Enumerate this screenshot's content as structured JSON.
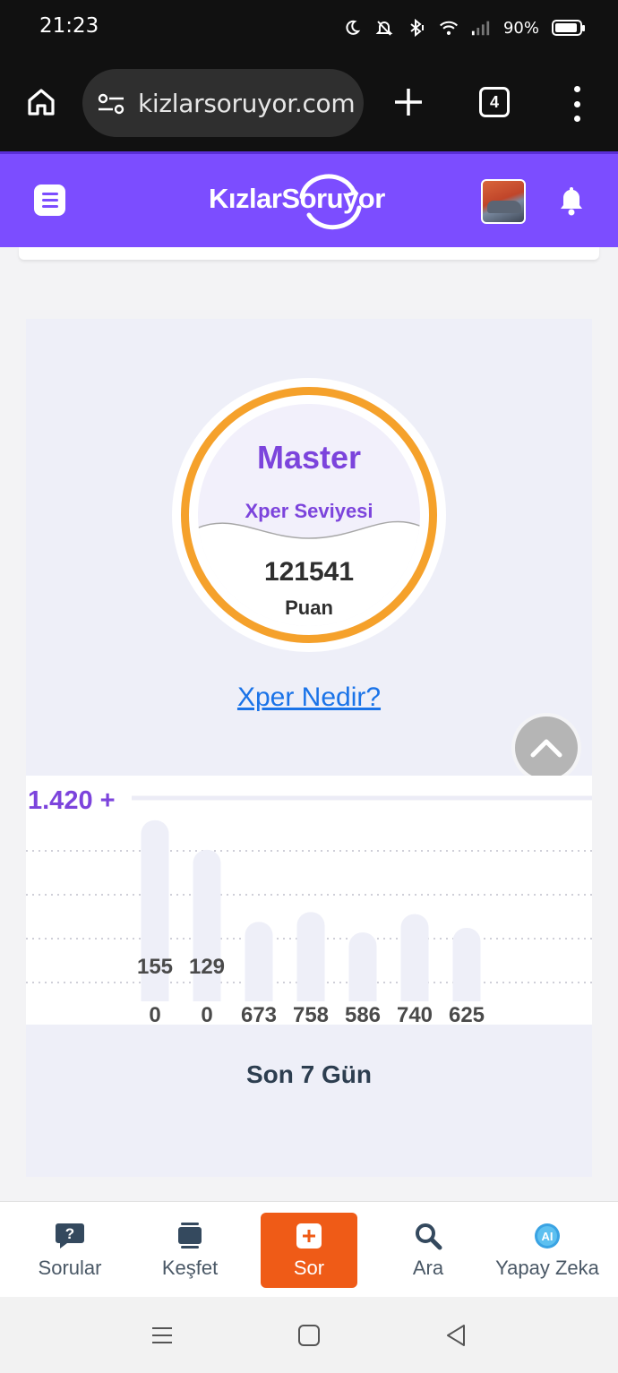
{
  "status_bar": {
    "time": "21:23",
    "battery": "90%"
  },
  "browser": {
    "url": "kizlarsoruyor.com",
    "tab_count": "4"
  },
  "site": {
    "logo": {
      "part1": "Kızlar",
      "part2": "Soruyor"
    }
  },
  "xper": {
    "level": "Master",
    "level_label": "Xper Seviyesi",
    "points": "121541",
    "points_label": "Puan",
    "link_text": "Xper Nedir?"
  },
  "chart_data": {
    "type": "bar",
    "max_label": "1.420 +",
    "categories": [
      "",
      "",
      "",
      "",
      "",
      "",
      ""
    ],
    "series": [
      {
        "values": [
          155,
          129,
          673,
          758,
          586,
          740,
          625
        ]
      },
      {
        "values": [
          0,
          0,
          673,
          758,
          586,
          740,
          625
        ]
      }
    ],
    "top_labels": [
      "155",
      "129",
      "",
      "",
      "",
      "",
      ""
    ],
    "bottom_labels": [
      "0",
      "0",
      "673",
      "758",
      "586",
      "740",
      "625"
    ],
    "bar_levels": [
      1380,
      1155,
      605,
      680,
      525,
      665,
      560
    ],
    "ylim": [
      0,
      1420
    ],
    "grid": true,
    "caption": "Son 7 Gün"
  },
  "bottom_nav": {
    "items": [
      {
        "label": "Sorular"
      },
      {
        "label": "Keşfet"
      },
      {
        "label": "Sor"
      },
      {
        "label": "Ara"
      },
      {
        "label": "Yapay Zeka"
      }
    ]
  },
  "colors": {
    "brand_purple": "#7c4dff",
    "accent_orange": "#f5a12b",
    "sor_orange": "#ef5b17"
  }
}
